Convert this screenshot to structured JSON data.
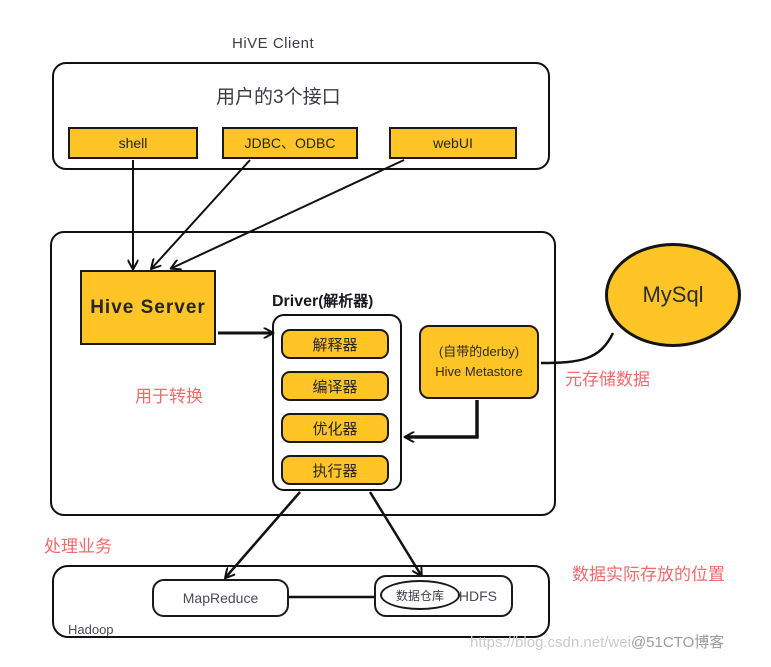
{
  "title": "HiVE  Client",
  "client": {
    "heading": "用户的3个接口",
    "interfaces": [
      {
        "label": "shell",
        "name": "shell"
      },
      {
        "label": "JDBC、ODBC",
        "name": "jdbc-odbc"
      },
      {
        "label": "webUI",
        "name": "webui"
      }
    ]
  },
  "hive": {
    "server_label": "Hive  Server",
    "driver_label": "Driver",
    "driver_sub_label": "(解析器)",
    "stages": [
      {
        "label": "解释器"
      },
      {
        "label": "编译器"
      },
      {
        "label": "优化器"
      },
      {
        "label": "执行器"
      }
    ],
    "metastore": {
      "line1": "(自带的derby)",
      "line2": "Hive Metastore"
    }
  },
  "mysql": {
    "label": "MySql"
  },
  "hadoop": {
    "label": "Hadoop",
    "mapreduce_label": "MapReduce",
    "hdfs_label": "HDFS",
    "warehouse_label": "数据仓库"
  },
  "annotations": {
    "convert": "用于转换",
    "metastore_data": "元存储数据",
    "business": "处理业务",
    "data_location": "数据实际存放的位置",
    "color": "#F4696B"
  },
  "watermark": {
    "url": "https://blog.csdn.net/wei",
    "suffix": "@51CTO博客"
  },
  "colors": {
    "accent_yellow": "#FFC425",
    "stroke": "#111111",
    "text": "#3c3c44",
    "red": "#F4696B"
  }
}
